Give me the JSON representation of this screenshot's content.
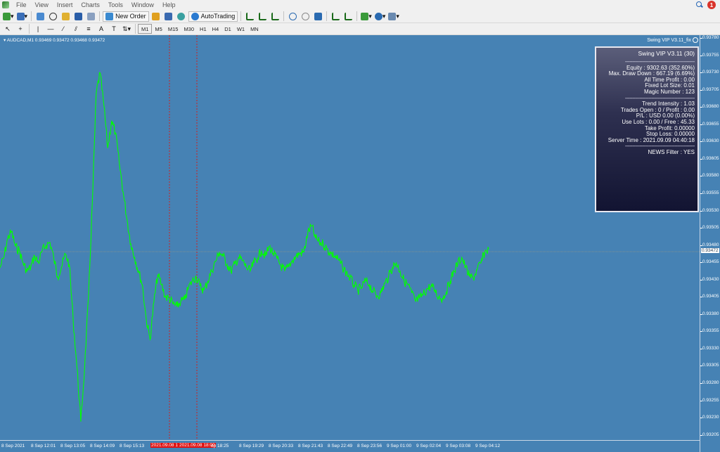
{
  "menu": [
    "File",
    "View",
    "Insert",
    "Charts",
    "Tools",
    "Window",
    "Help"
  ],
  "notifications_count": "1",
  "toolbar": {
    "new_order": "New Order",
    "autotrading": "AutoTrading"
  },
  "timeframes": [
    "M1",
    "M5",
    "M15",
    "M30",
    "H1",
    "H4",
    "D1",
    "W1",
    "MN"
  ],
  "chart": {
    "symbol_info": "AUDCAD,M1  0.93469 0.93472 0.93468 0.93472",
    "ea_name": "Swing VIP V3.11_fix",
    "current_price": "0.93472",
    "price_labels": [
      "0.93780",
      "0.93755",
      "0.93730",
      "0.93705",
      "0.93680",
      "0.93655",
      "0.93630",
      "0.93605",
      "0.93580",
      "0.93555",
      "0.93530",
      "0.93505",
      "0.93480",
      "0.93455",
      "0.93430",
      "0.93405",
      "0.93380",
      "0.93355",
      "0.93330",
      "0.93305",
      "0.93280",
      "0.93255",
      "0.93230",
      "0.93205"
    ],
    "time_labels": [
      "8 Sep 2021",
      "8 Sep 12:01",
      "8 Sep 13:05",
      "8 Sep 14:09",
      "8 Sep 15:13",
      "2021.09.08 1",
      "2021.09.08 18:00",
      "ep 18:25",
      "8 Sep 19:29",
      "8 Sep 20:33",
      "8 Sep 21:43",
      "8 Sep 22:49",
      "8 Sep 23:56",
      "9 Sep 01:00",
      "9 Sep 02:04",
      "9 Sep 03:08",
      "9 Sep 04:12"
    ],
    "line_color": "#00ff00",
    "background_color": "#4682b4"
  },
  "chart_data": {
    "type": "line",
    "series": [
      {
        "values": [
          0.93445,
          0.9346,
          0.93488,
          0.93498,
          0.93476,
          0.9347,
          0.93452,
          0.9344,
          0.93446,
          0.93462,
          0.93452,
          0.9347,
          0.93478,
          0.93482,
          0.93458,
          0.93432,
          0.93446,
          0.93465,
          0.9345,
          0.9337,
          0.933,
          0.9322,
          0.933,
          0.93402,
          0.9354,
          0.937,
          0.9373,
          0.93682,
          0.9362,
          0.9366,
          0.93642,
          0.93598,
          0.93556,
          0.93516,
          0.9348,
          0.9346,
          0.9344,
          0.9342,
          0.9337,
          0.9334,
          0.93395,
          0.93435,
          0.9342,
          0.93402,
          0.934,
          0.93392,
          0.93388,
          0.93396,
          0.93398,
          0.93416,
          0.93426,
          0.93432,
          0.93418,
          0.93412,
          0.93425,
          0.9344,
          0.93454,
          0.93468,
          0.93462,
          0.9345,
          0.9344,
          0.9345,
          0.9346,
          0.93455,
          0.93446,
          0.9344,
          0.93452,
          0.9346,
          0.9347,
          0.93462,
          0.93476,
          0.93466,
          0.93458,
          0.93448,
          0.9344,
          0.93446,
          0.93456,
          0.93462,
          0.93466,
          0.93468,
          0.93496,
          0.93506,
          0.93488,
          0.93482,
          0.9348,
          0.93472,
          0.93466,
          0.93462,
          0.93456,
          0.93446,
          0.93438,
          0.9343,
          0.9342,
          0.93412,
          0.93416,
          0.93426,
          0.9342,
          0.9341,
          0.93404,
          0.93408,
          0.93422,
          0.93432,
          0.93446,
          0.93452,
          0.9344,
          0.93426,
          0.9342,
          0.93408,
          0.93396,
          0.934,
          0.93406,
          0.93414,
          0.93418,
          0.93412,
          0.93402,
          0.934,
          0.9341,
          0.93426,
          0.9344,
          0.93452,
          0.9346,
          0.93446,
          0.93432,
          0.9343,
          0.93442,
          0.93452,
          0.93468,
          0.93472
        ]
      }
    ],
    "x_first": "8 Sep 2021",
    "x_last": "9 Sep 04:12",
    "ylim": [
      0.93193,
      0.93785
    ],
    "grid": false
  },
  "panel": {
    "title": "Swing VIP V3.11 (30)",
    "dash": "------------------------------------------------",
    "rows_a": [
      "Equity : 9302.63 (352.60%)",
      "Max. Draw Down : 667.19 (6.69%)",
      "All Time Profit : 0.00",
      "Fixed Lot Size: 0.01",
      "Magic Number : 123"
    ],
    "rows_b": [
      "Trend Intensity : 1.03",
      "Trades Open : 0 / Profit : 0.00",
      "P/L : USD 0.00 (0.00%)",
      "Use Lots : 0.00 / Free : 45.33",
      "Take Profit: 0.00000",
      "Stop Loss: 0.00000",
      "Server Time : 2021.09.09 04:40:18"
    ],
    "news": "NEWS Filter : YES"
  }
}
